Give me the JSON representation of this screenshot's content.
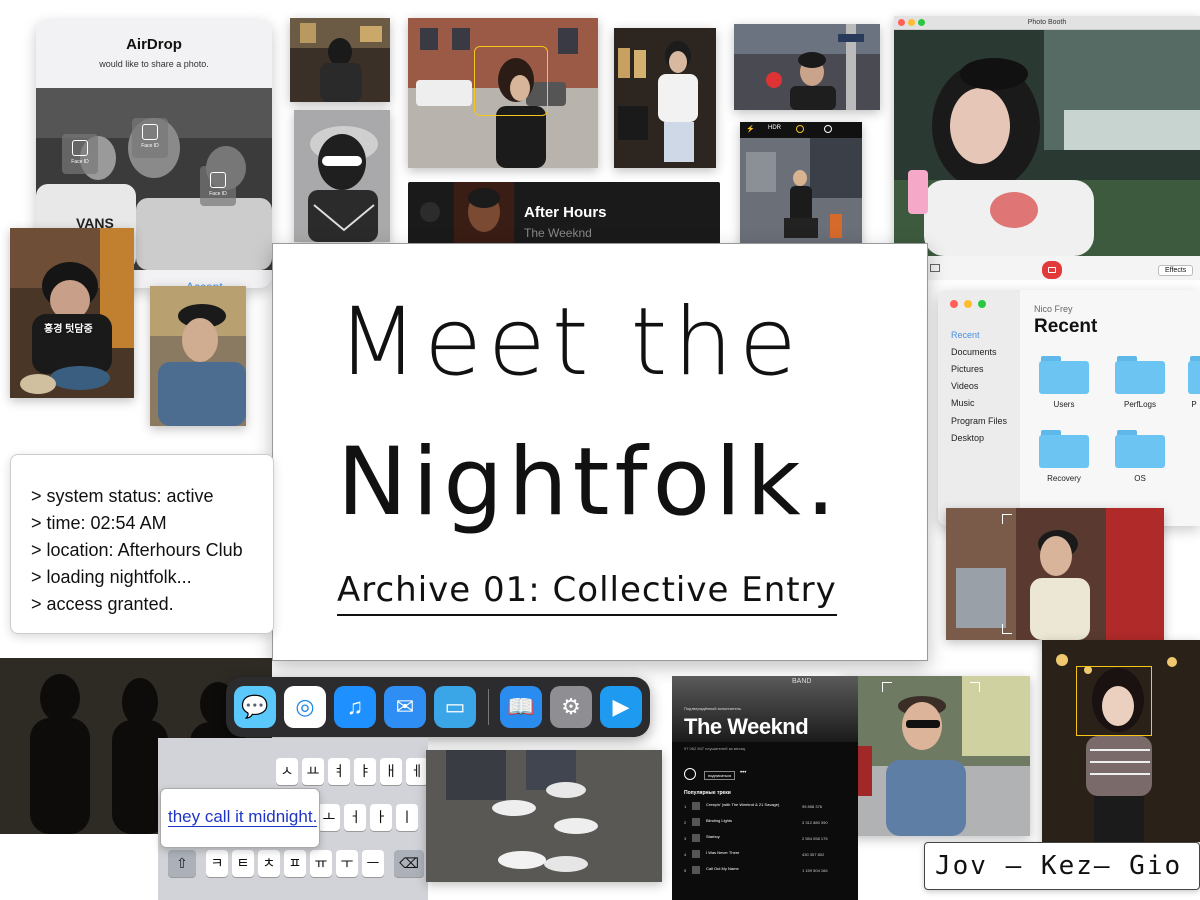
{
  "airdrop": {
    "title": "AirDrop",
    "subtitle": "would like to share a photo.",
    "accept_label": "Accept",
    "face_id_label": "Face ID"
  },
  "title_card": {
    "line1": "Meet the",
    "line2": "Nightfolk.",
    "subtitle": "Archive 01: Collective Entry"
  },
  "terminal": {
    "lines": [
      "> system status: active",
      "> time: 02:54 AM",
      "> location: Afterhours Club",
      "> loading nightfolk...",
      "> access granted."
    ]
  },
  "music_tile": {
    "song": "After Hours",
    "artist": "The Weeknd"
  },
  "photo_booth": {
    "window_title": "Photo Booth",
    "effects_label": "Effects"
  },
  "camera": {
    "hdr_label": "HDR"
  },
  "finder": {
    "user": "Nico Frey",
    "heading": "Recent",
    "sidebar": [
      "Recent",
      "Documents",
      "Pictures",
      "Videos",
      "Music",
      "Program Files",
      "Desktop"
    ],
    "folders": [
      "Users",
      "PerfLogs",
      "P",
      "Recovery",
      "OS"
    ]
  },
  "dock": {
    "apps": [
      "messages-app-icon",
      "safari-app-icon",
      "music-app-icon",
      "mail-app-icon",
      "files-app-icon",
      "books-app-icon",
      "settings-app-icon",
      "facetime-app-icon"
    ]
  },
  "keyboard": {
    "row1": [
      "ㅅ",
      "ㅛ",
      "ㅕ",
      "ㅑ",
      "ㅐ",
      "ㅔ"
    ],
    "row2": [
      "ㅗ",
      "ㅓ",
      "ㅏ",
      "ㅣ"
    ],
    "row3": [
      "ㅋ",
      "ㅌ",
      "ㅊ",
      "ㅍ",
      "ㅠ",
      "ㅜ",
      "ㅡ"
    ]
  },
  "text_bubble": "they call it midnight.",
  "spotify": {
    "verified": "Подтверждённый исполнитель",
    "artist": "The Weeknd",
    "listeners": "97 062 847 слушателей за месяц",
    "subscribe_label": "подписаться",
    "section": "Популярные треки",
    "tracks": [
      {
        "n": "1",
        "title": "Creepin' (with The Weeknd & 21 Savage)",
        "plays": "95 858 376"
      },
      {
        "n": "2",
        "title": "Blinding Lights",
        "plays": "3 312 880 390"
      },
      {
        "n": "3",
        "title": "Starboy",
        "plays": "2 554 058 175"
      },
      {
        "n": "4",
        "title": "I Was Never There",
        "plays": "430 357 802"
      },
      {
        "n": "5",
        "title": "Call Out My Name",
        "plays": "1 159 504 166"
      }
    ]
  },
  "poster_text": "홍경 텃담중",
  "band_sign": "BAND",
  "credits": "Jov — Kez— Gio",
  "colors": {
    "accent_blue": "#1f35c8",
    "folder_blue": "#6cc4f2",
    "shutter_red": "#e23a3a",
    "focus_yellow": "#f5c518"
  }
}
